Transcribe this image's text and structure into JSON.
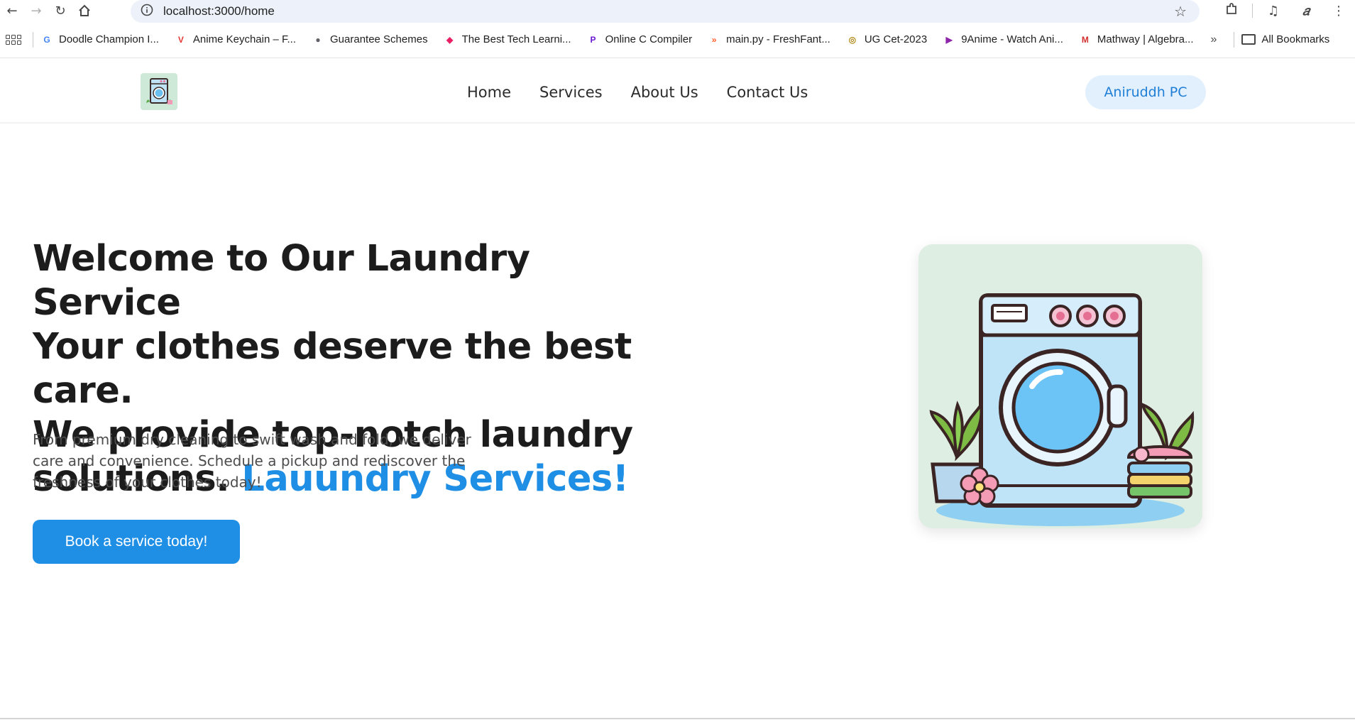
{
  "browser": {
    "url": "localhost:3000/home",
    "bookmarks": [
      {
        "label": "Doodle Champion I...",
        "icon": "google-icon",
        "color": "#4285f4"
      },
      {
        "label": "Anime Keychain – F...",
        "icon": "v-logo-icon",
        "color": "#e53935"
      },
      {
        "label": "Guarantee Schemes",
        "icon": "globe-icon",
        "color": "#5f6368"
      },
      {
        "label": "The Best Tech Learni...",
        "icon": "diamond-logo-icon",
        "color": "#e91e63"
      },
      {
        "label": "Online C Compiler",
        "icon": "p-logo-icon",
        "color": "#6a1bd1"
      },
      {
        "label": "main.py - FreshFant...",
        "icon": "code-logo-icon",
        "color": "#ff5722"
      },
      {
        "label": "UG Cet-2023",
        "icon": "emblem-icon",
        "color": "#b58a1b"
      },
      {
        "label": "9Anime - Watch Ani...",
        "icon": "play-icon",
        "color": "#8e24aa"
      },
      {
        "label": "Mathway | Algebra...",
        "icon": "m-logo-icon",
        "color": "#d32f2f"
      }
    ],
    "more_label": "»",
    "all_bookmarks": "All Bookmarks"
  },
  "site": {
    "nav": [
      "Home",
      "Services",
      "About Us",
      "Contact Us"
    ],
    "user": "Aniruddh PC"
  },
  "hero": {
    "title_lines": [
      "Welcome to Our Laundry Service",
      "Your clothes deserve the best care.",
      "We provide top-notch laundry",
      "solutions."
    ],
    "title_accent": "Lauundry Services!",
    "description": "From premium dry cleaning to swift wash and fold, we deliver care and convenience. Schedule a pickup and rediscover the freshness of your clothes today!",
    "cta": "Book a service today!"
  },
  "colors": {
    "accent": "#1f8fe6",
    "pill_bg": "#e2f0fd",
    "image_bg": "#dfeee3"
  }
}
